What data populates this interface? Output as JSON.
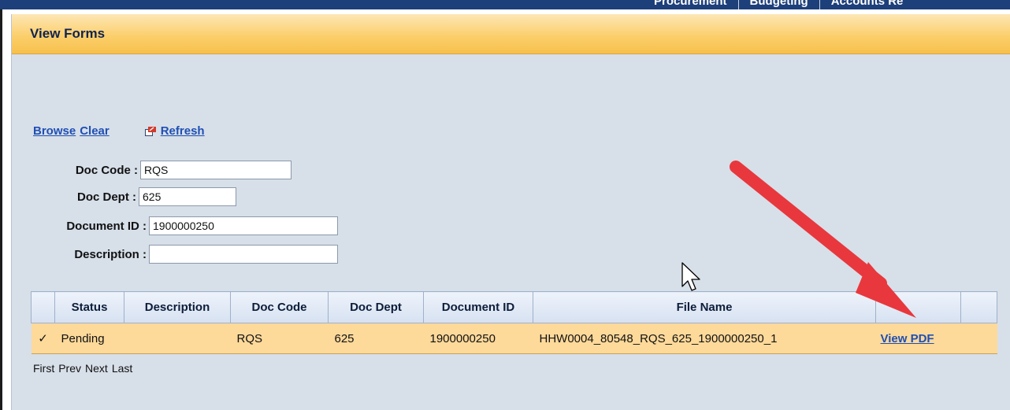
{
  "top_nav": [
    "Procurement",
    "Budgeting",
    "Accounts Re"
  ],
  "page_title": "View Forms",
  "actions": {
    "browse": "Browse",
    "clear": "Clear",
    "refresh": "Refresh"
  },
  "form": {
    "doc_code": {
      "label": "Doc Code :",
      "value": "RQS"
    },
    "doc_dept": {
      "label": "Doc Dept :",
      "value": "625"
    },
    "document_id": {
      "label": "Document ID :",
      "value": "1900000250"
    },
    "description": {
      "label": "Description :",
      "value": ""
    }
  },
  "table": {
    "columns": [
      "",
      "Status",
      "Description",
      "Doc Code",
      "Doc Dept",
      "Document ID",
      "File Name",
      "",
      ""
    ],
    "rows": [
      {
        "check": "✓",
        "status": "Pending",
        "description": "",
        "doc_code": "RQS",
        "doc_dept": "625",
        "document_id": "1900000250",
        "file_name": "HHW0004_80548_RQS_625_1900000250_1",
        "action": "View PDF"
      }
    ]
  },
  "pager": {
    "first": "First",
    "prev": "Prev",
    "next": "Next",
    "last": "Last"
  },
  "colors": {
    "header_orange": "#fbcf6c",
    "row_highlight": "#fdd99a",
    "link_blue": "#1f4fb3",
    "annotation_arrow": "#e8383d"
  }
}
